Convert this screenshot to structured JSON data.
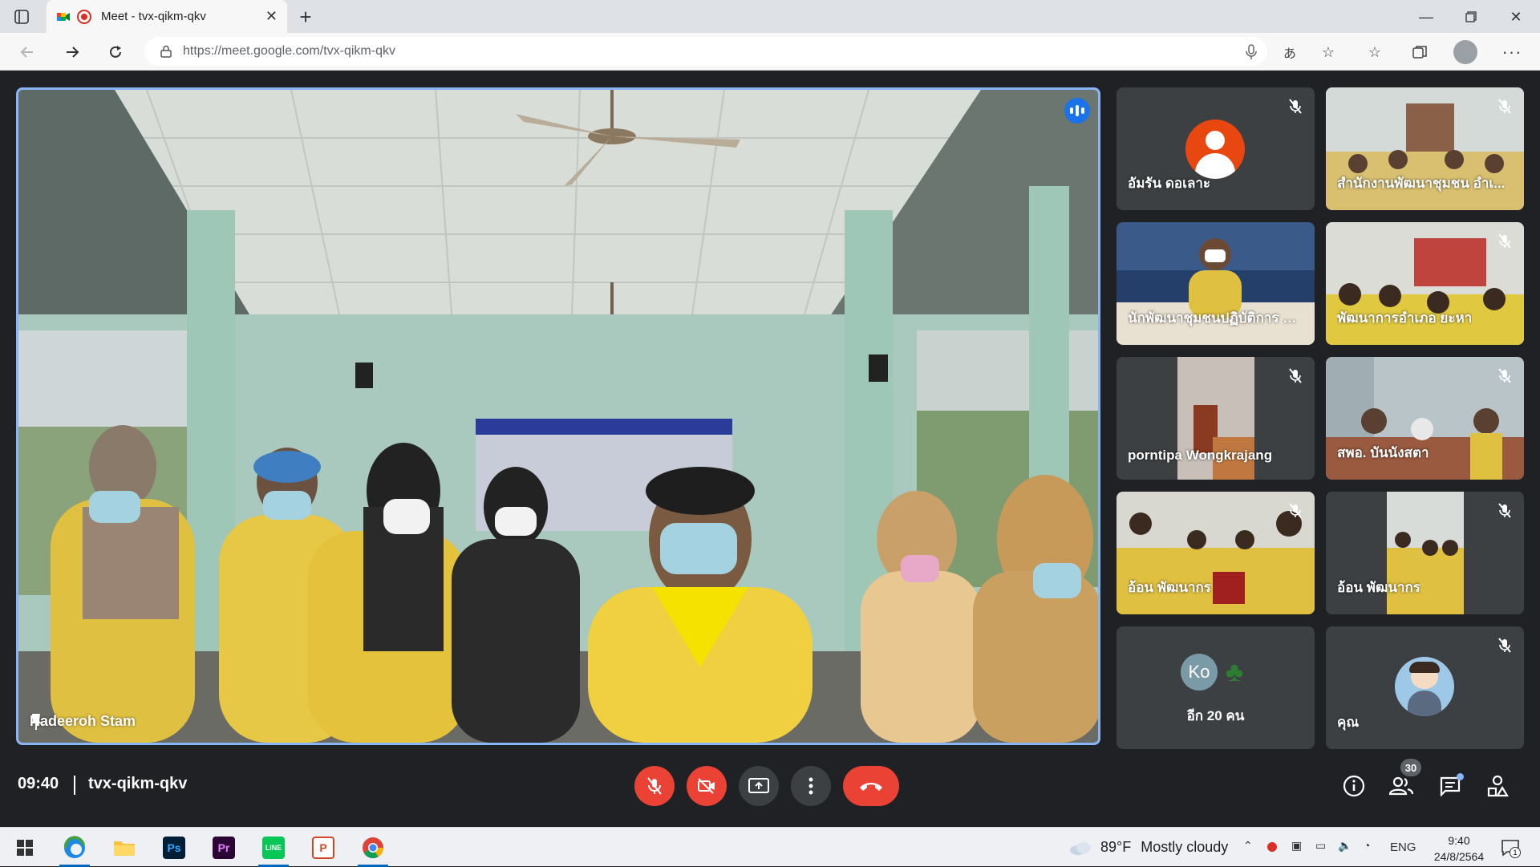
{
  "browser": {
    "tab_title": "Meet - tvx-qikm-qkv",
    "url": "https://meet.google.com/tvx-qikm-qkv"
  },
  "meeting": {
    "main_speaker": "Nadeeroh Stam",
    "tiles": [
      {
        "name": "อัมรัน ดอเลาะ",
        "type": "avatar",
        "muted": true
      },
      {
        "name": "สำนักงานพัฒนาชุมชน อำเ...",
        "type": "video",
        "muted": true
      },
      {
        "name": "นักพัฒนาชุมชนปฏิบัติการ สา...",
        "type": "video",
        "muted": false
      },
      {
        "name": "พัฒนาการอำเภอ ยะหา",
        "type": "video",
        "muted": true
      },
      {
        "name": "porntipa Wongkrajang",
        "type": "video",
        "muted": true
      },
      {
        "name": "สพอ. บันนังสตา",
        "type": "video",
        "muted": true
      },
      {
        "name": "อ้อน พัฒนากร",
        "type": "video",
        "muted": true
      },
      {
        "name": "อ้อน พัฒนากร",
        "type": "video",
        "muted": true
      },
      {
        "name": "อีก 20 คน",
        "type": "more",
        "avatar_text": "Ko"
      },
      {
        "name": "คุณ",
        "type": "self",
        "muted": true
      }
    ],
    "clock": "09:40",
    "code": "tvx-qikm-qkv",
    "participant_count": "30"
  },
  "taskbar": {
    "weather_temp": "89°F",
    "weather_desc": "Mostly cloudy",
    "lang": "ENG",
    "time": "9:40",
    "date": "24/8/2564",
    "notifications": "1",
    "apps": [
      "edge",
      "file-explorer",
      "photoshop",
      "premiere",
      "line",
      "powerpoint",
      "chrome"
    ]
  },
  "colors": {
    "meet_bg": "#202124",
    "tile_bg": "#3c4043",
    "accent_blue": "#8ab4f8",
    "danger_red": "#ea4335"
  }
}
